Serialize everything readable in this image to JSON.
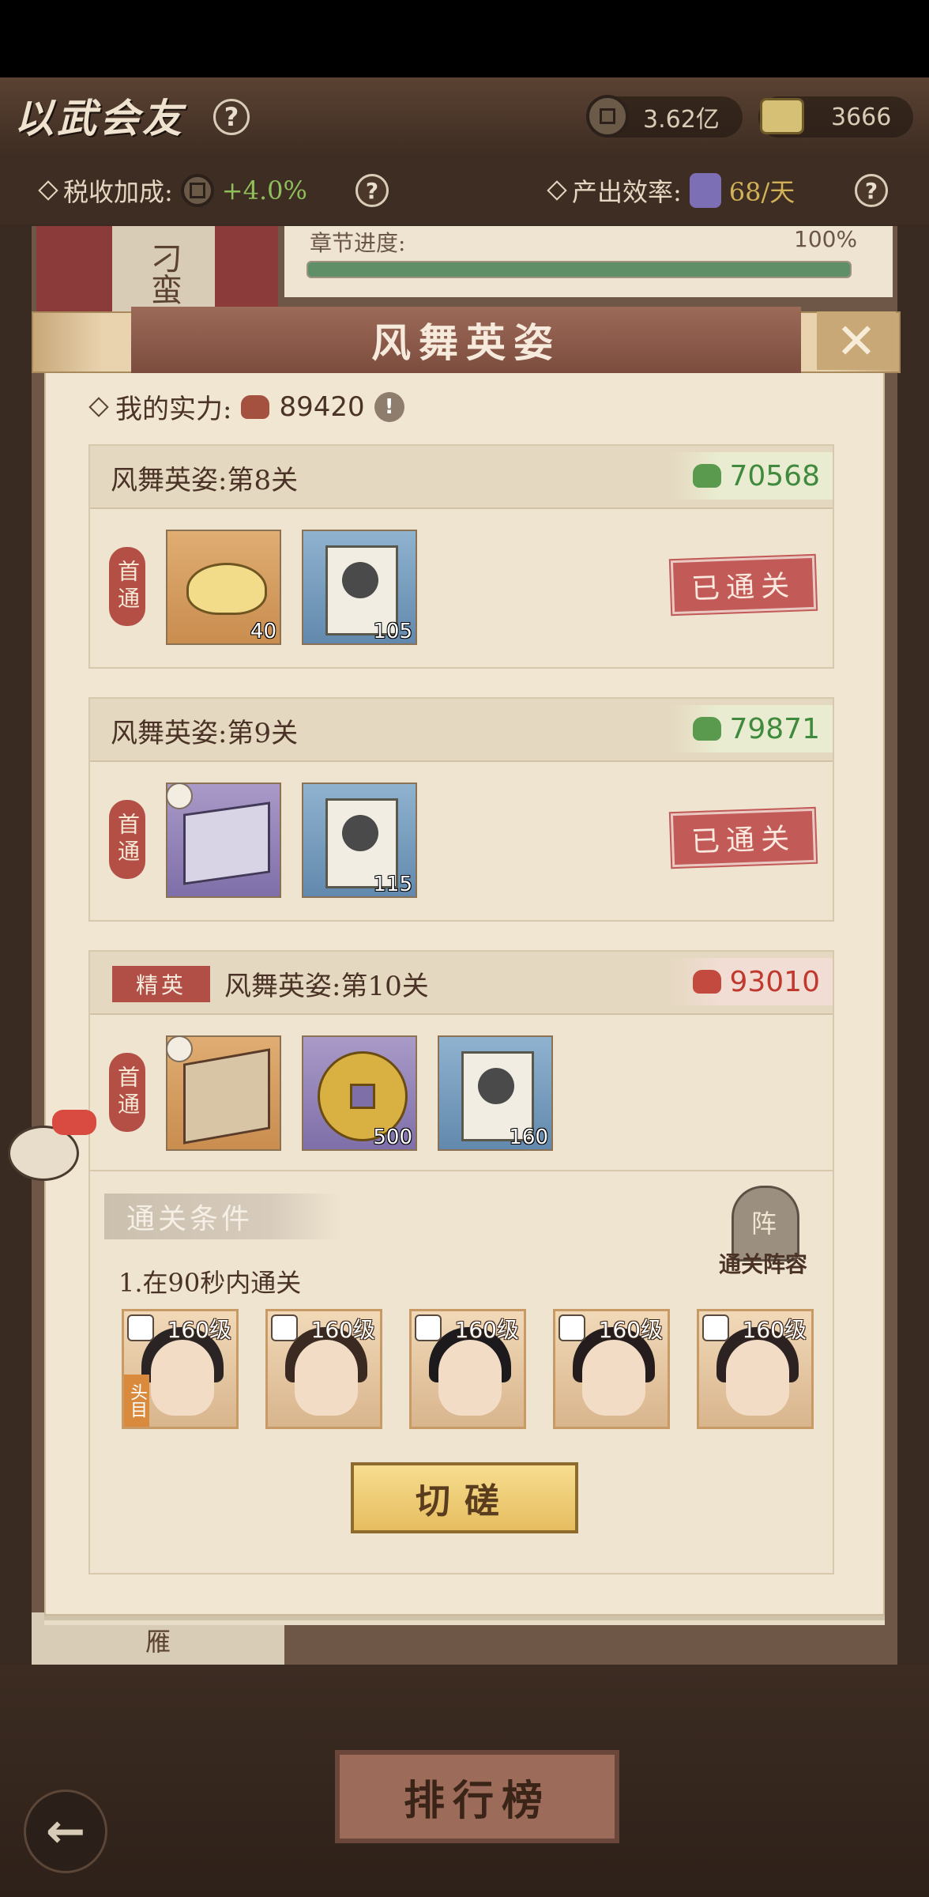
{
  "header": {
    "title": "以武会友",
    "coins": "3.62亿",
    "tokens": "3666"
  },
  "subbar": {
    "tax_label": "税收加成:",
    "tax_value": "+4.0%",
    "output_label": "产出效率:",
    "output_value": "68/天"
  },
  "background": {
    "side_label": "刁蛮",
    "progress_label": "章节进度:",
    "progress_value": "100%",
    "progress_fraction": 1.0,
    "lower_label": "雁"
  },
  "dialog": {
    "title": "风舞英姿",
    "close_symbol": "✕",
    "my_power_label": "我的实力:",
    "my_power_value": "89420",
    "warn_symbol": "!",
    "first_clear_label": "首通",
    "cleared_label": "已通关",
    "stages": [
      {
        "title": "风舞英姿:第8关",
        "power": "70568",
        "rewards": [
          {
            "qty": "40"
          },
          {
            "qty": "105"
          }
        ]
      },
      {
        "title": "风舞英姿:第9关",
        "power": "79871",
        "rewards": [
          {
            "qty": ""
          },
          {
            "qty": "115"
          }
        ]
      },
      {
        "title": "风舞英姿:第10关",
        "elite_label": "精英",
        "power": "93010",
        "rewards": [
          {
            "qty": ""
          },
          {
            "qty": "500"
          },
          {
            "qty": "160"
          }
        ]
      }
    ],
    "conditions_title": "通关条件",
    "condition_1": "1.在90秒内通关",
    "lineup_label": "通关阵容",
    "lineup_seal": "阵",
    "heroes": [
      {
        "level": "160级",
        "leader": "头目"
      },
      {
        "level": "160级"
      },
      {
        "level": "160级"
      },
      {
        "level": "160级"
      },
      {
        "level": "160级"
      }
    ],
    "challenge_label": "切磋"
  },
  "footer": {
    "rank_label": "排行榜",
    "back_symbol": "←"
  },
  "colors": {
    "accent_red": "#c25a58",
    "power_green": "#5a9a4e",
    "power_red": "#c24a3e",
    "button_gold": "#e6bd5f"
  }
}
